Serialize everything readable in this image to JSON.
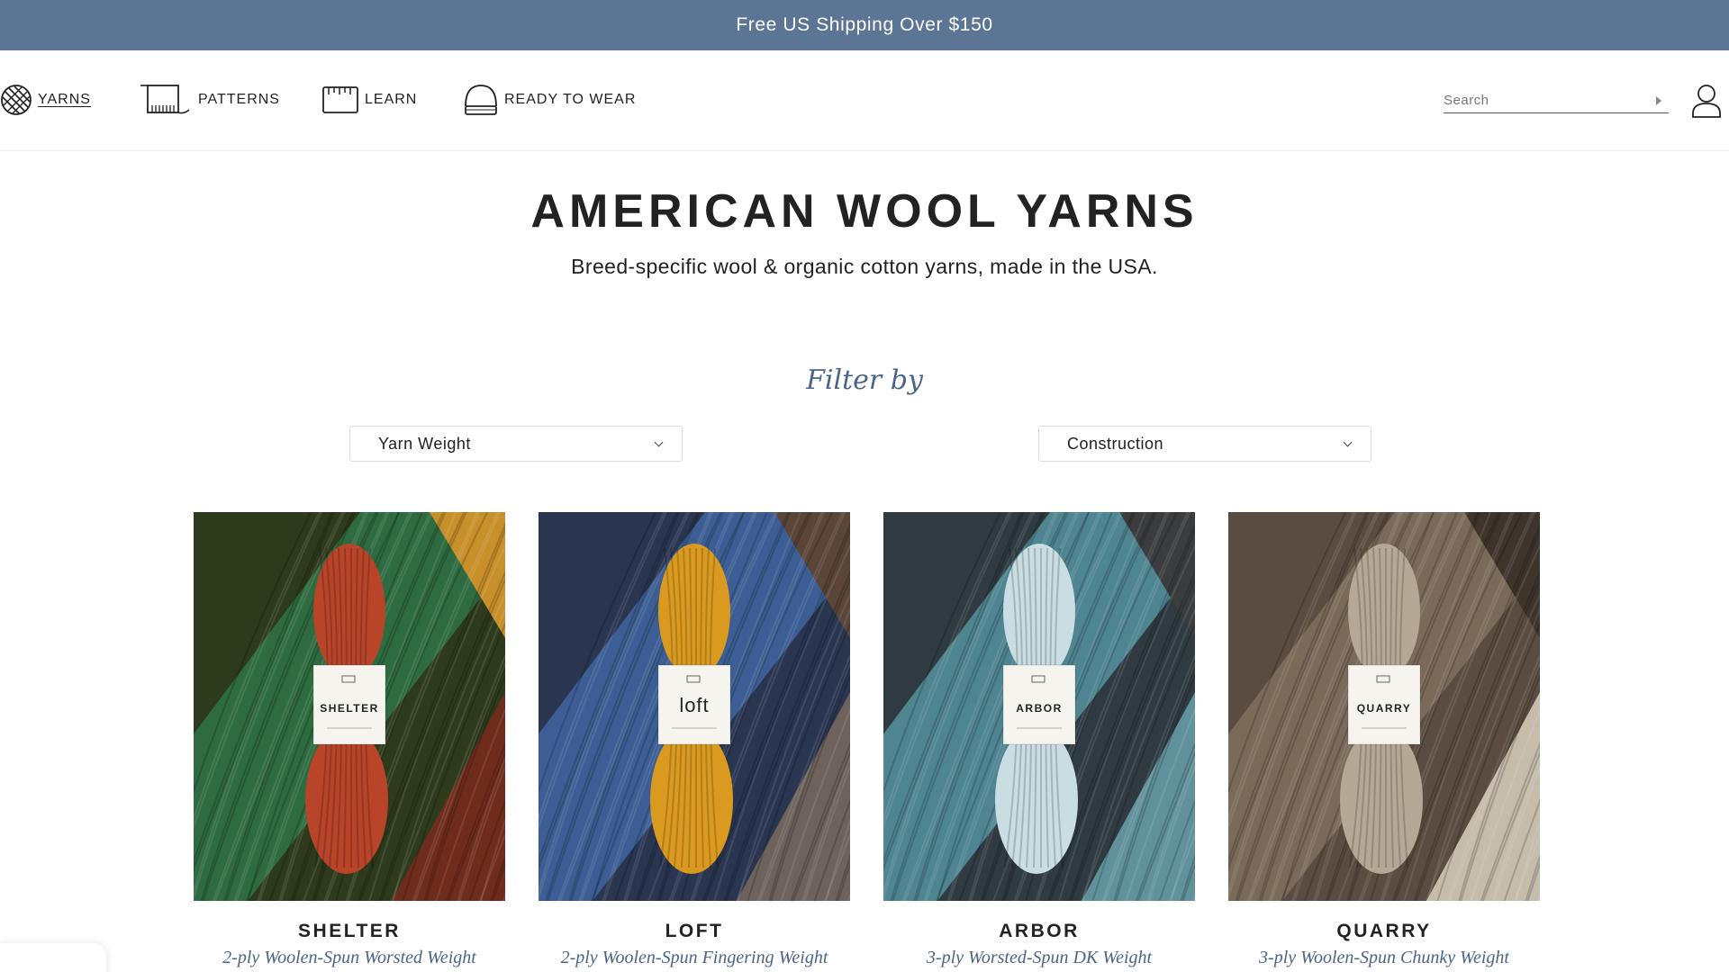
{
  "promo": {
    "text": "Free US Shipping Over $150"
  },
  "nav": {
    "items": [
      {
        "label": "YARNS",
        "icon": "yarn-ball-icon",
        "active": true
      },
      {
        "label": "PATTERNS",
        "icon": "knitting-pattern-icon",
        "active": false
      },
      {
        "label": "LEARN",
        "icon": "ruler-icon",
        "active": false
      },
      {
        "label": "READY TO WEAR",
        "icon": "beanie-hat-icon",
        "active": false
      }
    ],
    "search_placeholder": "Search",
    "account_icon": "user-account-icon"
  },
  "hero": {
    "title": "AMERICAN WOOL YARNS",
    "subtitle": "Breed-specific wool & organic cotton yarns, made in the USA."
  },
  "filters": {
    "heading": "Filter by",
    "yarn_weight": "Yarn Weight",
    "construction": "Construction"
  },
  "products": [
    {
      "name": "SHELTER",
      "description": "2-ply Woolen-Spun Worsted Weight",
      "label": "SHELTER",
      "skein_color": "#b8442a",
      "bg_colors": [
        "#2e3a1c",
        "#2f6b40",
        "#c8902a",
        "#7a2a1c"
      ]
    },
    {
      "name": "LOFT",
      "description": "2-ply Woolen-Spun Fingering Weight",
      "label": "loft",
      "skein_color": "#d99a1f",
      "bg_colors": [
        "#2a3550",
        "#3c5e94",
        "#5a4538",
        "#7a6a5e"
      ]
    },
    {
      "name": "ARBOR",
      "description": "3-ply Worsted-Spun DK Weight",
      "label": "ARBOR",
      "skein_color": "#c9dde2",
      "bg_colors": [
        "#2f3b40",
        "#4f8591",
        "#3a3c3e",
        "#6aa2ad"
      ]
    },
    {
      "name": "QUARRY",
      "description": "3-ply Woolen-Spun Chunky Weight",
      "label": "QUARRY",
      "skein_color": "#b5a896",
      "bg_colors": [
        "#5a4c40",
        "#7a6a5a",
        "#3e342c",
        "#d8d0c0"
      ]
    }
  ]
}
